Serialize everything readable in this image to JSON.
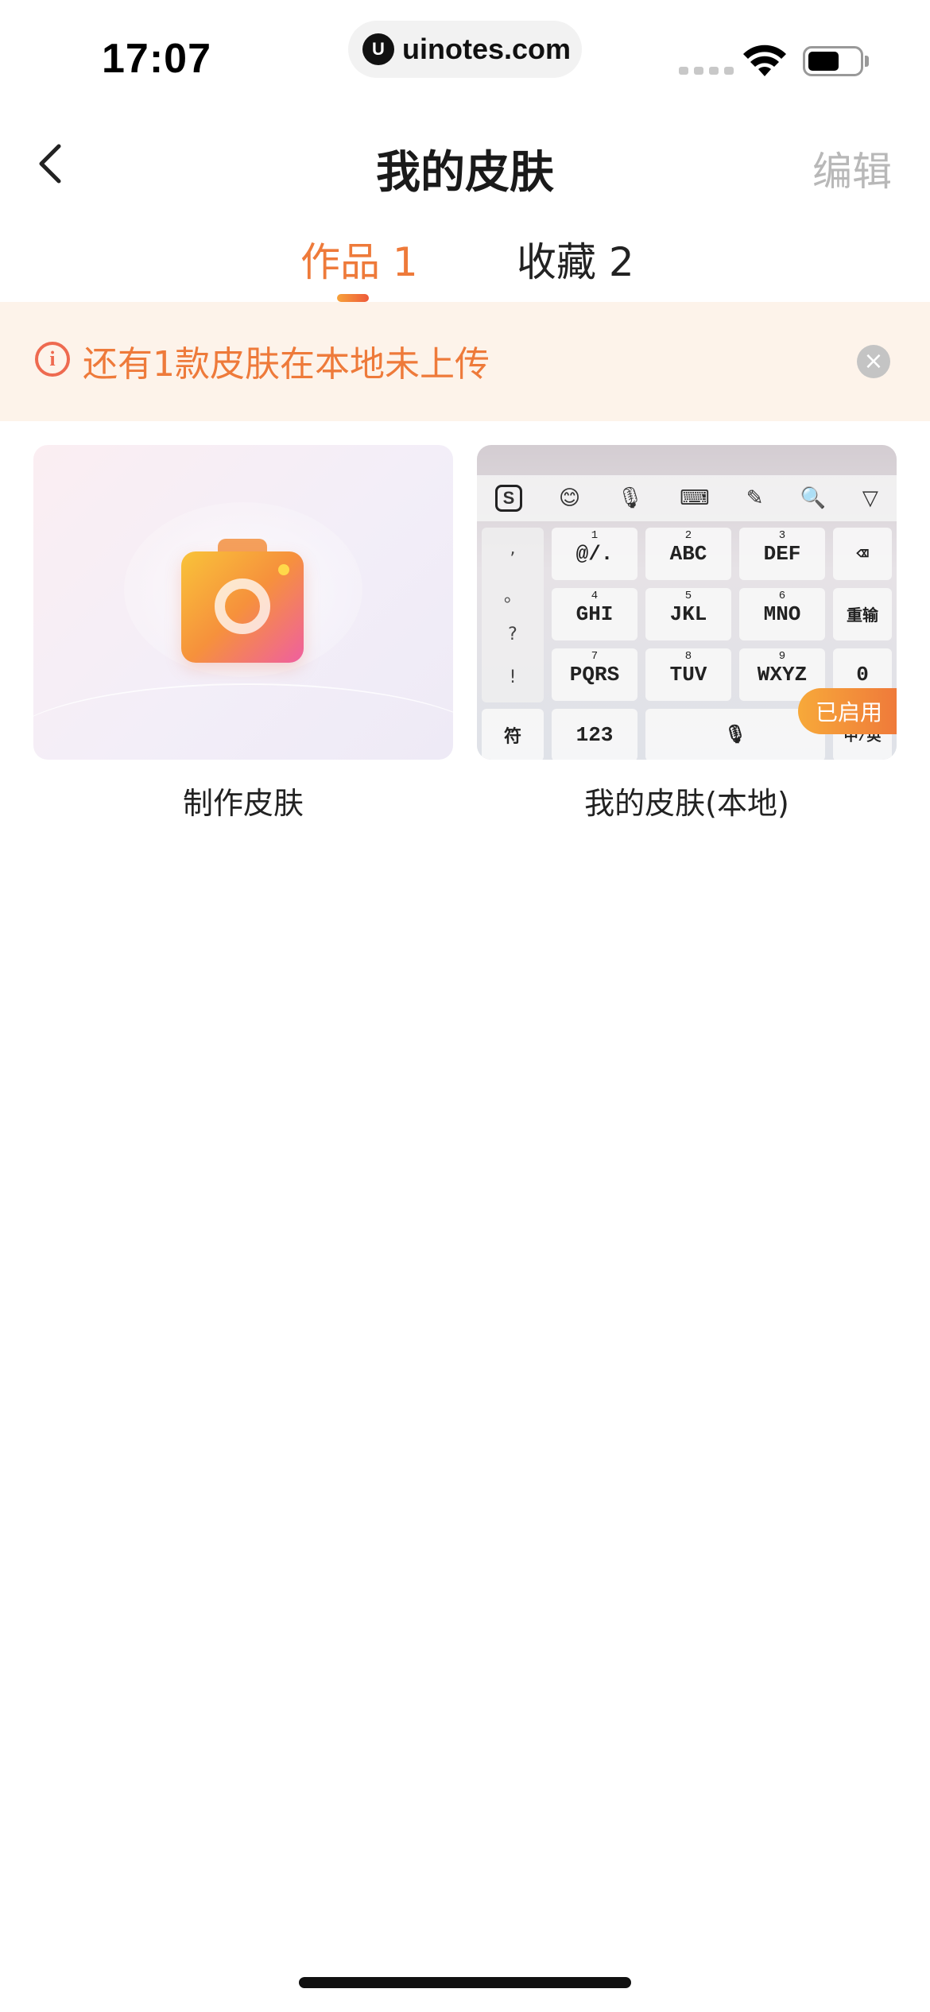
{
  "status_bar": {
    "time": "17:07",
    "url": "uinotes.com",
    "url_logo": "U"
  },
  "nav": {
    "title": "我的皮肤",
    "edit_label": "编辑",
    "back_icon": "chevron-left-icon"
  },
  "tabs": [
    {
      "label": "作品 1",
      "active": true
    },
    {
      "label": "收藏 2",
      "active": false
    }
  ],
  "banner": {
    "text": "还有1款皮肤在本地未上传",
    "info_icon": "i",
    "close_icon": "×"
  },
  "cards": [
    {
      "label": "制作皮肤",
      "icon": "camera-icon"
    },
    {
      "label": "我的皮肤(本地)",
      "badge": "已启用"
    }
  ],
  "keyboard_preview": {
    "logo": "S",
    "toolbar_icons": [
      "😊",
      "🎙",
      "⌨",
      "✎",
      "🔍",
      "▽"
    ],
    "side_keys": [
      ",",
      "。",
      "?",
      "!"
    ],
    "rows": [
      [
        {
          "num": "1",
          "label": "@/."
        },
        {
          "num": "2",
          "label": "ABC"
        },
        {
          "num": "3",
          "label": "DEF"
        },
        {
          "num": "",
          "label": "⌫"
        }
      ],
      [
        {
          "num": "4",
          "label": "GHI"
        },
        {
          "num": "5",
          "label": "JKL"
        },
        {
          "num": "6",
          "label": "MNO"
        },
        {
          "num": "",
          "label": "重输"
        }
      ],
      [
        {
          "num": "7",
          "label": "PQRS"
        },
        {
          "num": "8",
          "label": "TUV"
        },
        {
          "num": "9",
          "label": "WXYZ"
        },
        {
          "num": "",
          "label": "0"
        }
      ]
    ],
    "bottom_keys": [
      "符",
      "123",
      "🎙",
      "中/英"
    ]
  },
  "colors": {
    "accent": "#ee7a3a",
    "banner_bg": "#fdf3ea",
    "muted": "#b8b8b8"
  }
}
